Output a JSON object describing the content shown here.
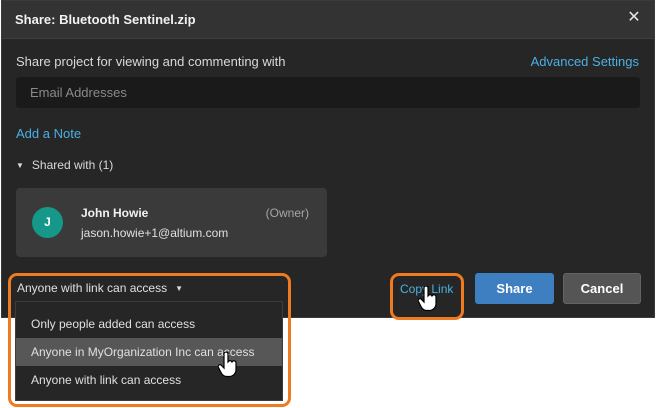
{
  "dialog": {
    "title": "Share: Bluetooth Sentinel.zip",
    "close_glyph": "✕",
    "share_label": "Share project for viewing and commenting with",
    "advanced_settings": "Advanced Settings",
    "email_placeholder": "Email Addresses",
    "add_note": "Add a Note",
    "shared_with_label": "Shared with (1)",
    "caret_glyph": "▼"
  },
  "shared_users": [
    {
      "initial": "J",
      "name": "John Howie",
      "email": "jason.howie+1@altium.com",
      "role": "(Owner)",
      "avatar_color": "#159789"
    }
  ],
  "footer": {
    "access_selected": "Anyone with link can access",
    "copy_link": "Copy Link",
    "share_button": "Share",
    "cancel_button": "Cancel"
  },
  "access_options": [
    "Only people added can access",
    "Anyone in MyOrganization Inc can access",
    "Anyone with link can access"
  ],
  "hovered_option_index": 1,
  "colors": {
    "accent_link": "#4ab0e4",
    "primary_button": "#3e7fc1",
    "highlight_outline": "#f07a1f",
    "dialog_bg": "#262626"
  }
}
